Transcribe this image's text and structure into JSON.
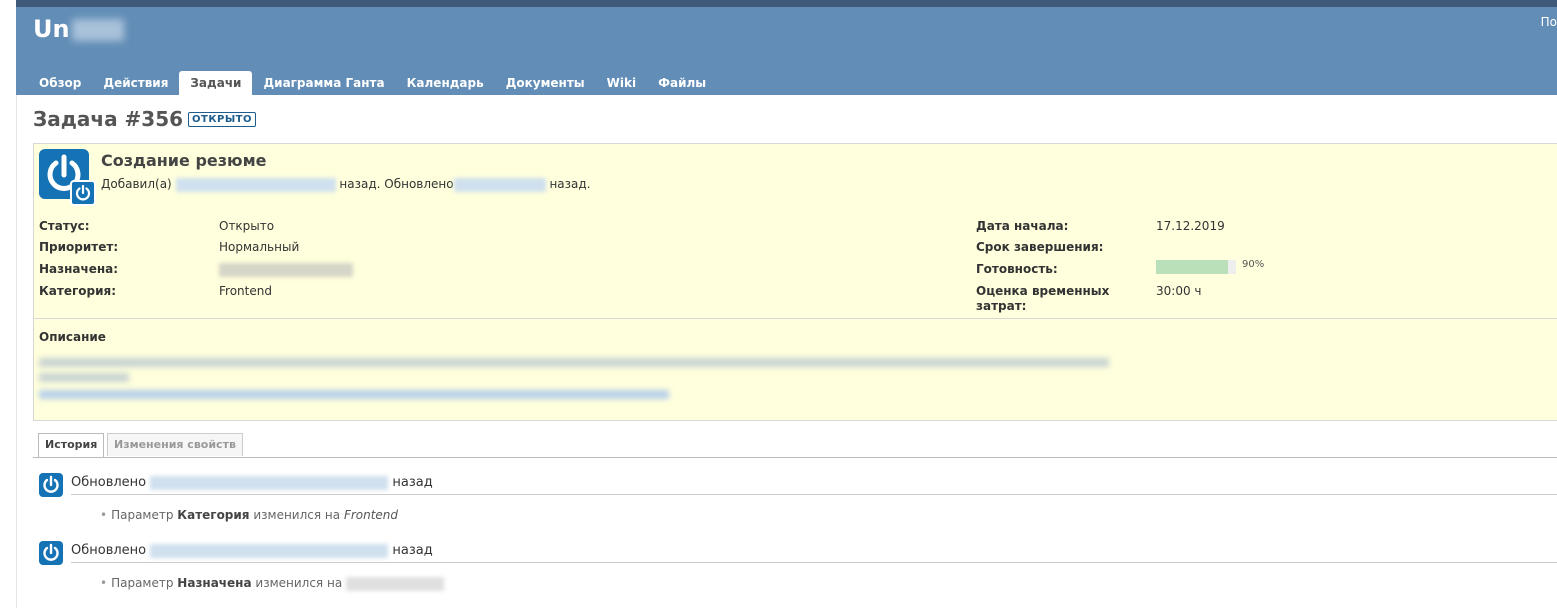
{
  "header": {
    "project_name": "Un",
    "right_text": "По"
  },
  "tabs": [
    "Обзор",
    "Действия",
    "Задачи",
    "Диаграмма Ганта",
    "Календарь",
    "Документы",
    "Wiki",
    "Файлы"
  ],
  "issue": {
    "title": "Задача #356",
    "status_badge": "ОТКРЫТО",
    "subject": "Создание резюме",
    "added_by_prefix": "Добавил(а)",
    "added_suffix": "назад. Обновлено",
    "updated_suffix": "назад.",
    "attributes_left": [
      {
        "label": "Статус:",
        "value": "Открыто"
      },
      {
        "label": "Приоритет:",
        "value": "Нормальный"
      },
      {
        "label": "Назначена:",
        "value": ""
      },
      {
        "label": "Категория:",
        "value": "Frontend"
      }
    ],
    "attributes_right": [
      {
        "label": "Дата начала:",
        "value": "17.12.2019"
      },
      {
        "label": "Срок завершения:",
        "value": ""
      },
      {
        "label": "Готовность:",
        "value": "90%"
      },
      {
        "label": "Оценка временных затрат:",
        "value": "30:00 ч"
      }
    ],
    "done_ratio": 0.9,
    "description_label": "Описание"
  },
  "history_tabs": [
    "История",
    "Изменения свойств"
  ],
  "journals": [
    {
      "updated_label": "Обновлено",
      "ago_label": "назад",
      "param_prefix": "Параметр",
      "param_name": "Категория",
      "changed_to": "изменился на",
      "new_value": "Frontend"
    },
    {
      "updated_label": "Обновлено",
      "ago_label": "назад",
      "param_prefix": "Параметр",
      "param_name": "Назначена",
      "changed_to": "изменился на",
      "new_value": ""
    }
  ],
  "colors": {
    "header_bg": "#628db6",
    "issue_bg": "#ffffdd",
    "avatar": "#1573b5",
    "progress": "#bae0ba"
  }
}
